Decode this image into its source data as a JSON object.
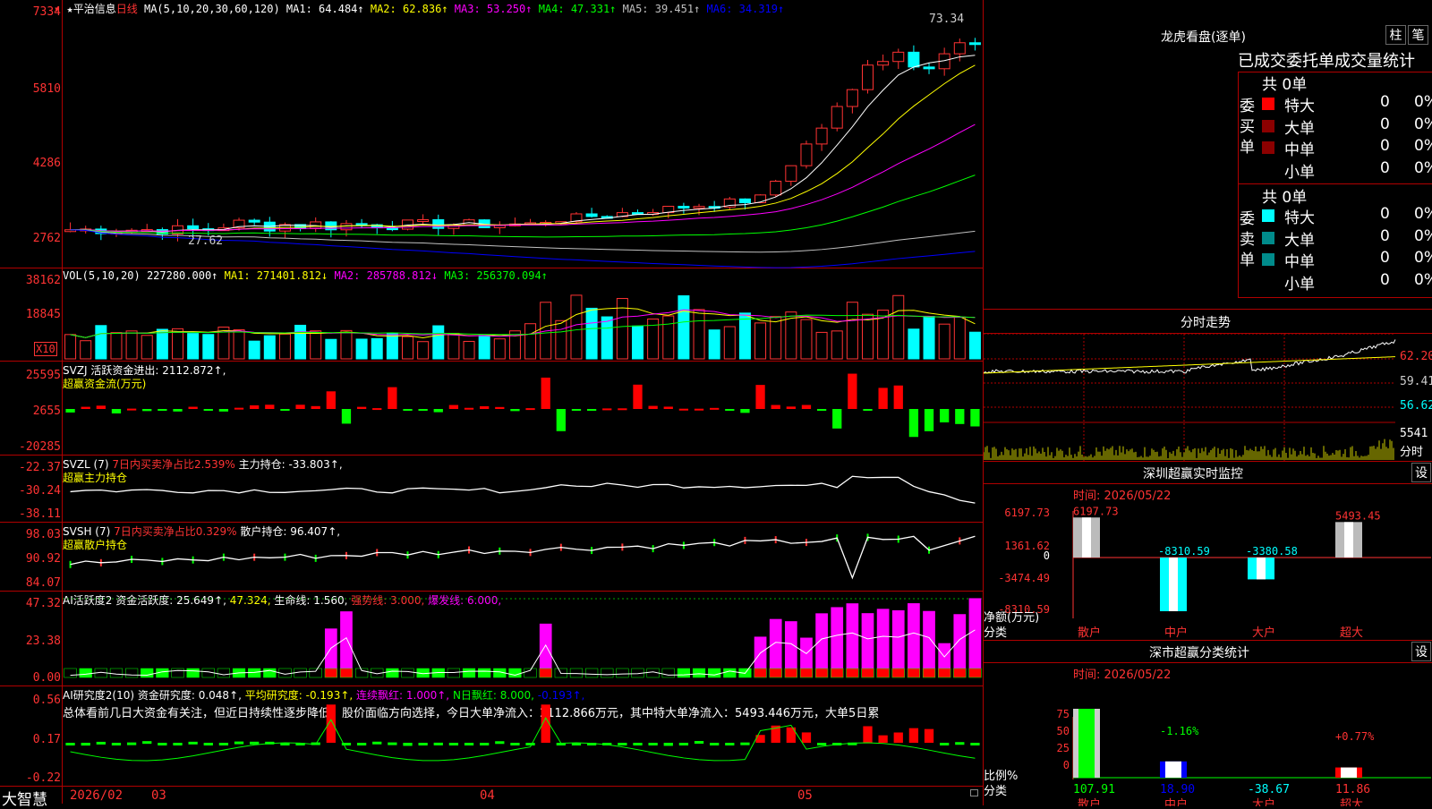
{
  "main": {
    "stock_star": "★",
    "stock_name": "平治信息",
    "period": "日线",
    "ma_params": "MA(5,10,20,30,60,120)",
    "ma_values": [
      {
        "label": "MA1:",
        "value": "64.484↑",
        "color": "#ffffff"
      },
      {
        "label": "MA2:",
        "value": "62.836↑",
        "color": "#ffff00"
      },
      {
        "label": "MA3:",
        "value": "53.250↑",
        "color": "#ff00ff"
      },
      {
        "label": "MA4:",
        "value": "47.331↑",
        "color": "#00ff00"
      },
      {
        "label": "MA5:",
        "value": "39.451↑",
        "color": "#c0c0c0"
      },
      {
        "label": "MA6:",
        "value": "34.319↑",
        "color": "#0000ff"
      }
    ],
    "price_ticks": [
      "7334",
      "5810",
      "4286",
      "2762"
    ],
    "high_mark": "73.34",
    "low_mark": "27.62"
  },
  "vol": {
    "title": "VOL(5,10,20)",
    "value": "227280.000↑",
    "ma1": "MA1: 271401.812↓",
    "ma2": "MA2: 285788.812↓",
    "ma3": "MA3: 256370.094↑",
    "ticks": [
      "38162",
      "18845"
    ],
    "unit": "X10"
  },
  "svzj": {
    "line1": "SVZJ  活跃资金进出: 2112.872↑,",
    "line2": "超赢资金流(万元)",
    "ticks": [
      "25595",
      "2655",
      "-20285"
    ]
  },
  "svzl": {
    "title": "SVZL (7)",
    "ratio": "7日内买卖净占比2.539%",
    "main": "主力持仓: -33.803↑,",
    "line2": "超赢主力持仓",
    "ticks": [
      "-22.37",
      "-30.24",
      "-38.11"
    ]
  },
  "svsh": {
    "title": "SVSH (7)",
    "ratio": "7日内买卖净占比0.329%",
    "main": "散户持仓: 96.407↑,",
    "line2": "超赢散户持仓",
    "ticks": [
      "98.03",
      "90.92",
      "84.07"
    ]
  },
  "ai_act": {
    "title": "AI活跃度2",
    "a": "资金活跃度: 25.649↑,",
    "b": "47.324,",
    "c": "生命线: 1.560,",
    "d": "强势线: 3.000,",
    "e": "爆发线: 6.000,",
    "ticks": [
      "47.32",
      "23.38",
      "0.00"
    ]
  },
  "ai_res": {
    "title": "AI研究度2(10)",
    "a": "资金研究度: 0.048↑,",
    "b": "平均研究度: -0.193↑,",
    "c": "连续飘红: 1.000↑,",
    "d": "N日飘红: 8.000,",
    "e": "-0.193↑,",
    "summary": "总体看前几日大资金有关注，但近日持续性逐步降低，股价面临方向选择，今日大单净流入：2112.866万元，其中特大单净流入：5493.446万元，大单5日累",
    "ticks": [
      "0.56",
      "0.17",
      "-0.22"
    ]
  },
  "bottom": {
    "brand": "大智慧",
    "dates": [
      "2026/02",
      "03",
      "04",
      "05"
    ]
  },
  "right": {
    "lhb_title": "龙虎看盘(逐单)",
    "btn_col": "柱",
    "btn_bi": "笔",
    "stats_title": "已成交委托单成交量统计",
    "buy_label": [
      "委",
      "买",
      "单"
    ],
    "sell_label": [
      "委",
      "卖",
      "单"
    ],
    "buy_total": "共 0单",
    "sell_total": "共 0单",
    "rows": [
      "特大",
      "大单",
      "中单",
      "小单"
    ],
    "zero": "0",
    "pct": "0%",
    "buy_colors": [
      "#ff0000",
      "#8b0000",
      "#8b0000",
      "#000000"
    ],
    "sell_colors": [
      "#00ffff",
      "#008b8b",
      "#008b8b",
      "#000000"
    ],
    "intraday_title": "分时走势",
    "intraday_ticks": [
      "62.20",
      "59.41",
      "56.62"
    ],
    "intraday_vol": "5541",
    "intraday_unit": "分时",
    "sz_title": "深圳超赢实时监控",
    "sz_btn": "设",
    "sz_time": "时间: 2026/05/22",
    "sz_ticks": [
      "6197.73",
      "1361.62",
      "0",
      "-3474.49",
      "-8310.59"
    ],
    "sz_axis": "净额(万元)",
    "sz_cat_label": "分类",
    "sz_values": [
      "6197.73",
      "-8310.59",
      "-3380.58",
      "5493.45"
    ],
    "cats": [
      "散户",
      "中户",
      "大户",
      "超大"
    ],
    "cls_title": "深市超赢分类统计",
    "cls_btn": "设",
    "cls_time": "时间: 2026/05/22",
    "cls_ticks": [
      "75",
      "50",
      "25",
      "0"
    ],
    "cls_axis": "比例%",
    "cls_cat_label": "分类",
    "cls_labels": [
      "-1.16%",
      "+0.77%"
    ],
    "cls_values": [
      "107.91",
      "18.90",
      "-38.67",
      "11.86"
    ]
  }
}
